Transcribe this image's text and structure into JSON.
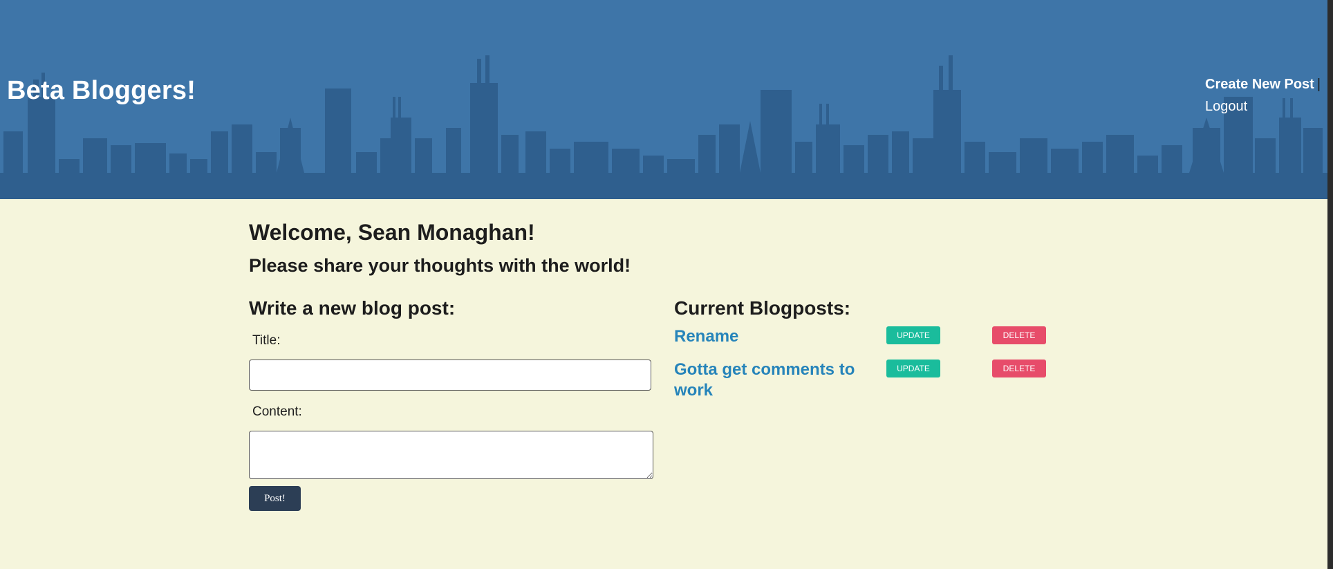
{
  "header": {
    "site_title": "Beta Bloggers!",
    "nav": {
      "create_label": "Create New Post",
      "separator": "|",
      "logout_label": "Logout"
    }
  },
  "main": {
    "welcome": "Welcome, Sean Monaghan!",
    "share": "Please share your thoughts with the world!",
    "form": {
      "section_title": "Write a new blog post:",
      "title_label": "Title:",
      "title_value": "",
      "content_label": "Content:",
      "content_value": "",
      "post_button": "Post!"
    },
    "posts": {
      "section_title": "Current Blogposts:",
      "items": [
        {
          "title": "Rename",
          "update_label": "UPDATE",
          "delete_label": "DELETE"
        },
        {
          "title": "Gotta get comments to work",
          "update_label": "UPDATE",
          "delete_label": "DELETE"
        }
      ]
    }
  },
  "colors": {
    "header_bg": "#3e75a8",
    "page_bg": "#f5f5dc",
    "link": "#2684ba",
    "update": "#1abc9c",
    "delete": "#e74c6a",
    "post_button": "#2c3e55"
  },
  "icons": {
    "banner": "city-skyline-icon"
  }
}
